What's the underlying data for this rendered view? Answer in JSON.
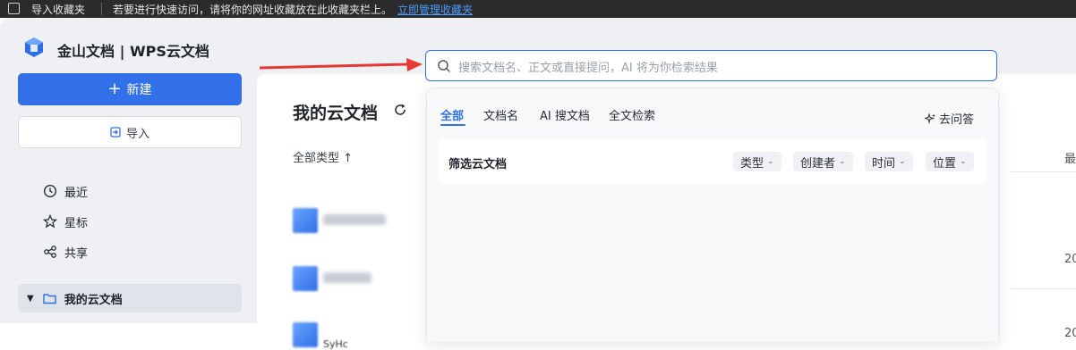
{
  "bookmark_bar": {
    "label": "导入收藏夹",
    "hint": "若要进行快速访问，请将你的网址收藏放在此收藏夹栏上。",
    "manage_link": "立即管理收藏夹"
  },
  "app": {
    "brand": "金山文档 | WPS云文档",
    "accent": "#3270e8",
    "new_button": "新建",
    "import_button": "导入",
    "nav": [
      {
        "label": "最近",
        "icon": "clock-icon"
      },
      {
        "label": "星标",
        "icon": "star-icon"
      },
      {
        "label": "共享",
        "icon": "share-icon"
      }
    ],
    "active_nav": "我的云文档"
  },
  "main": {
    "title": "我的云文档",
    "column_type": "全部类型 ↑",
    "edge_col": "最",
    "edge_date": "20",
    "edge_date2": "20",
    "partial_filename": "SyHc"
  },
  "search": {
    "placeholder": "搜索文档名、正文或直接提问，AI 将为你检索结果",
    "tabs": [
      "全部",
      "文档名",
      "AI 搜文档",
      "全文检索"
    ],
    "ask": "去问答",
    "filter_title": "筛选云文档",
    "filters": [
      "类型",
      "创建者",
      "时间",
      "位置"
    ]
  }
}
